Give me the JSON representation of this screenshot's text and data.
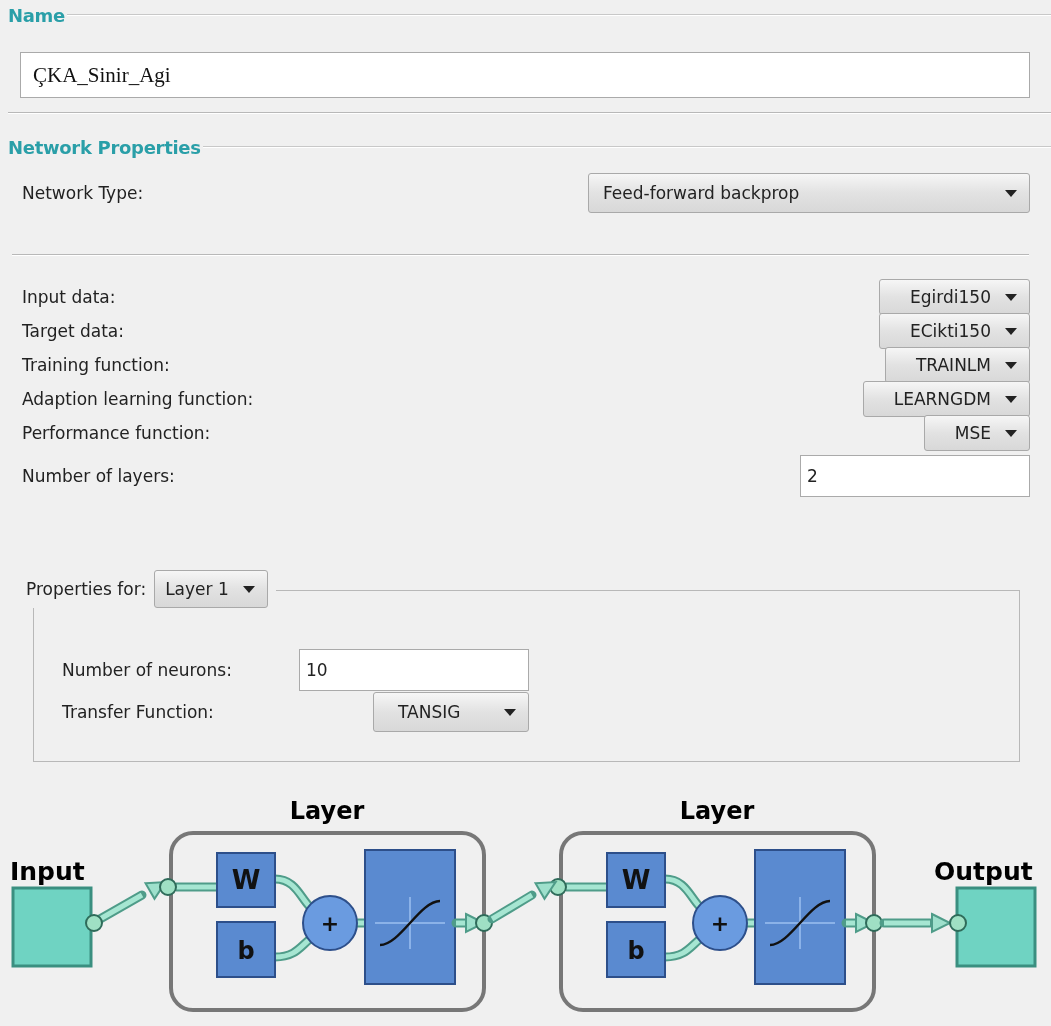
{
  "name_section": {
    "title": "Name",
    "value": "ÇKA_Sinir_Agi"
  },
  "network_properties": {
    "title": "Network Properties",
    "network_type": {
      "label": "Network Type:",
      "value": "Feed-forward backprop"
    },
    "fields": [
      {
        "kind": "dropdown",
        "label": "Input data:",
        "value": "Egirdi150"
      },
      {
        "kind": "dropdown",
        "label": "Target data:",
        "value": "ECikti150"
      },
      {
        "kind": "dropdown",
        "label": "Training function:",
        "value": "TRAINLM"
      },
      {
        "kind": "dropdown",
        "label": "Adaption learning function:",
        "value": "LEARNGDM"
      },
      {
        "kind": "dropdown",
        "label": "Performance function:",
        "value": "MSE"
      },
      {
        "kind": "input",
        "label": "Number of layers:",
        "value": "2"
      }
    ]
  },
  "layer_properties": {
    "label": "Properties for:",
    "layer": "Layer 1",
    "fields": [
      {
        "kind": "input",
        "label": "Number of neurons:",
        "value": "10"
      },
      {
        "kind": "dropdown",
        "label": "Transfer Function:",
        "value": "TANSIG"
      }
    ]
  },
  "diagram": {
    "input_label": "Input",
    "output_label": "Output",
    "layers": [
      {
        "title": "Layer",
        "weight": "W",
        "bias": "b",
        "sum": "+"
      },
      {
        "title": "Layer",
        "weight": "W",
        "bias": "b",
        "sum": "+"
      }
    ]
  }
}
